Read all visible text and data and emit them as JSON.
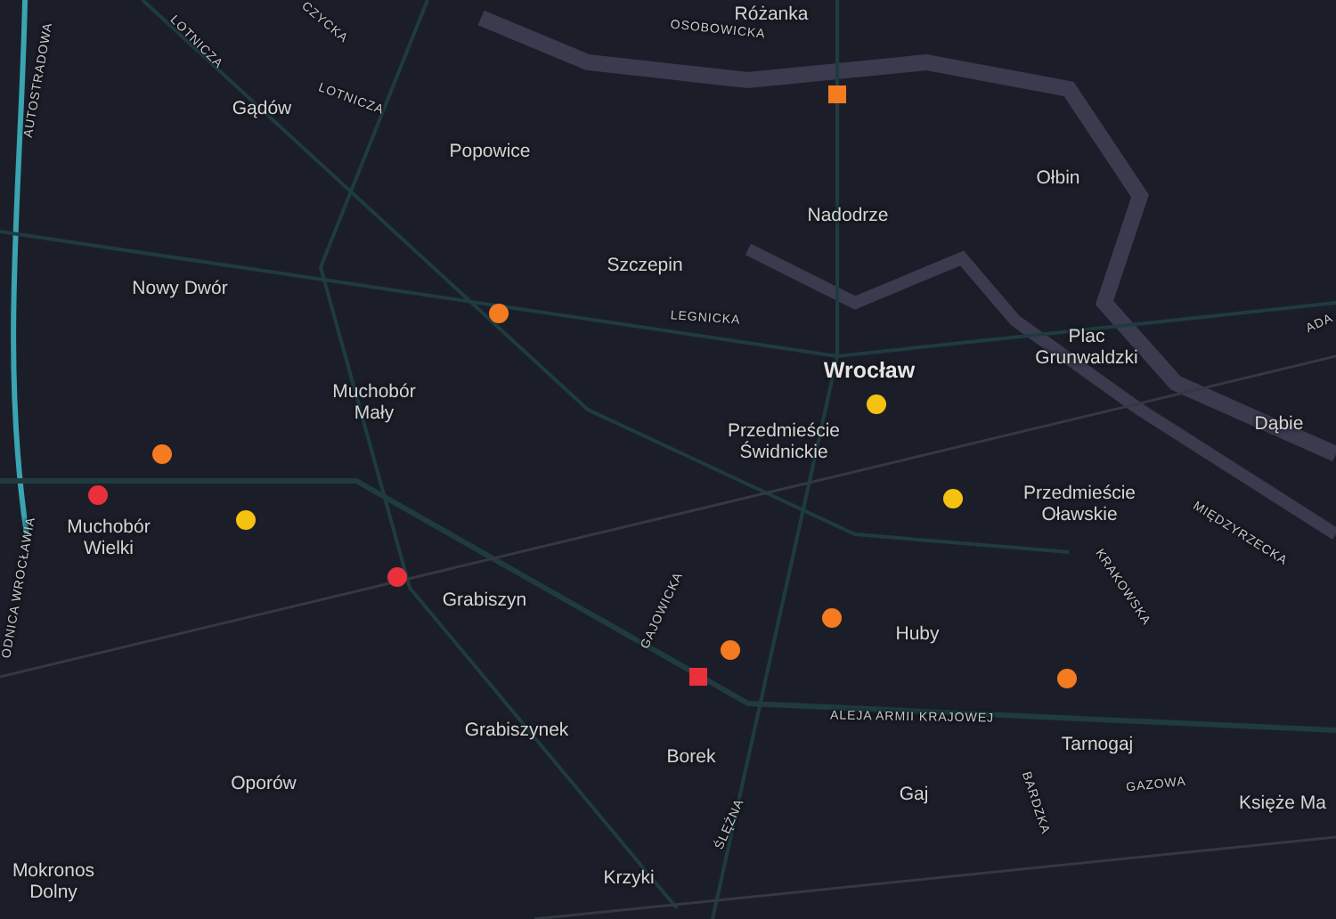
{
  "map": {
    "places": [
      {
        "label": "Różanka",
        "kind": "district"
      },
      {
        "label": "Gądów",
        "kind": "district"
      },
      {
        "label": "Popowice",
        "kind": "district"
      },
      {
        "label": "Ołbin",
        "kind": "district"
      },
      {
        "label": "Nadodrze",
        "kind": "district"
      },
      {
        "label": "Szczepin",
        "kind": "district"
      },
      {
        "label": "Nowy Dwór",
        "kind": "district"
      },
      {
        "label": "Plac Grunwaldzki",
        "kind": "district"
      },
      {
        "label": "Wrocław",
        "kind": "city"
      },
      {
        "label": "Muchobór Mały",
        "kind": "district"
      },
      {
        "label": "Przedmieście Świdnickie",
        "kind": "district"
      },
      {
        "label": "Dąbie",
        "kind": "district"
      },
      {
        "label": "Przedmieście Oławskie",
        "kind": "district"
      },
      {
        "label": "Muchobór Wielki",
        "kind": "district"
      },
      {
        "label": "Grabiszyn",
        "kind": "district"
      },
      {
        "label": "Huby",
        "kind": "district"
      },
      {
        "label": "Grabiszynek",
        "kind": "district"
      },
      {
        "label": "Tarnogaj",
        "kind": "district"
      },
      {
        "label": "Borek",
        "kind": "district"
      },
      {
        "label": "Oporów",
        "kind": "district"
      },
      {
        "label": "Gaj",
        "kind": "district"
      },
      {
        "label": "Księże Ma",
        "kind": "district"
      },
      {
        "label": "Mokronos Dolny",
        "kind": "district"
      },
      {
        "label": "Krzyki",
        "kind": "district"
      }
    ],
    "streets": [
      {
        "label": "AUTOSTRADOWA"
      },
      {
        "label": "LOTNICZA"
      },
      {
        "label": "CZYCKA"
      },
      {
        "label": "LOTNICZA"
      },
      {
        "label": "OSOBOWICKA"
      },
      {
        "label": "LEGNICKA"
      },
      {
        "label": "ADA"
      },
      {
        "label": "MIĘDZYRZECKA"
      },
      {
        "label": "ODNICA WROCŁAWIA"
      },
      {
        "label": "KRAKOWSKA"
      },
      {
        "label": "GAJOWICKA"
      },
      {
        "label": "ALEJA ARMII KRAJOWEJ"
      },
      {
        "label": "GAZOWA"
      },
      {
        "label": "BARDZKA"
      },
      {
        "label": "ŚLĘŻNA"
      }
    ],
    "markers": [
      {
        "kind": "square",
        "color": "#f47b20"
      },
      {
        "kind": "circle",
        "color": "#f47b20"
      },
      {
        "kind": "circle",
        "color": "#f5c211"
      },
      {
        "kind": "circle",
        "color": "#f47b20"
      },
      {
        "kind": "circle",
        "color": "#e9303b"
      },
      {
        "kind": "circle",
        "color": "#f5c211"
      },
      {
        "kind": "circle",
        "color": "#f5c211"
      },
      {
        "kind": "circle",
        "color": "#e9303b"
      },
      {
        "kind": "circle",
        "color": "#f47b20"
      },
      {
        "kind": "circle",
        "color": "#f47b20"
      },
      {
        "kind": "square",
        "color": "#e9303b"
      },
      {
        "kind": "circle",
        "color": "#f47b20"
      }
    ]
  }
}
